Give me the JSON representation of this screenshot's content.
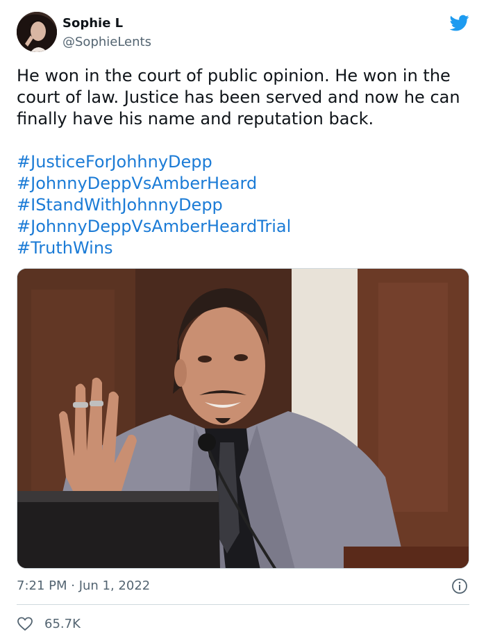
{
  "user": {
    "display_name": "Sophie L",
    "handle": "@SophieLents",
    "avatar_icon": "profile-photo"
  },
  "brand": {
    "icon": "twitter-bird-icon",
    "color": "#1d9bf0"
  },
  "tweet": {
    "text": "He won in the court of public opinion. He won in the court of law. Justice has been served and now he can finally have his name and reputation back.",
    "hashtags": [
      "#JusticeForJohhnyDepp",
      "#JohnnyDeppVsAmberHeard",
      "#IStandWithJohnnyDepp",
      "#JohnnyDeppVsAmberHeardTrial",
      "#TruthWins"
    ],
    "hashtag_color": "#1b7bd6",
    "media_caption": "",
    "timestamp": "7:21 PM · Jun 1, 2022",
    "likes": "65.7K"
  },
  "icons": {
    "info": "info-icon",
    "like": "heart-icon"
  }
}
